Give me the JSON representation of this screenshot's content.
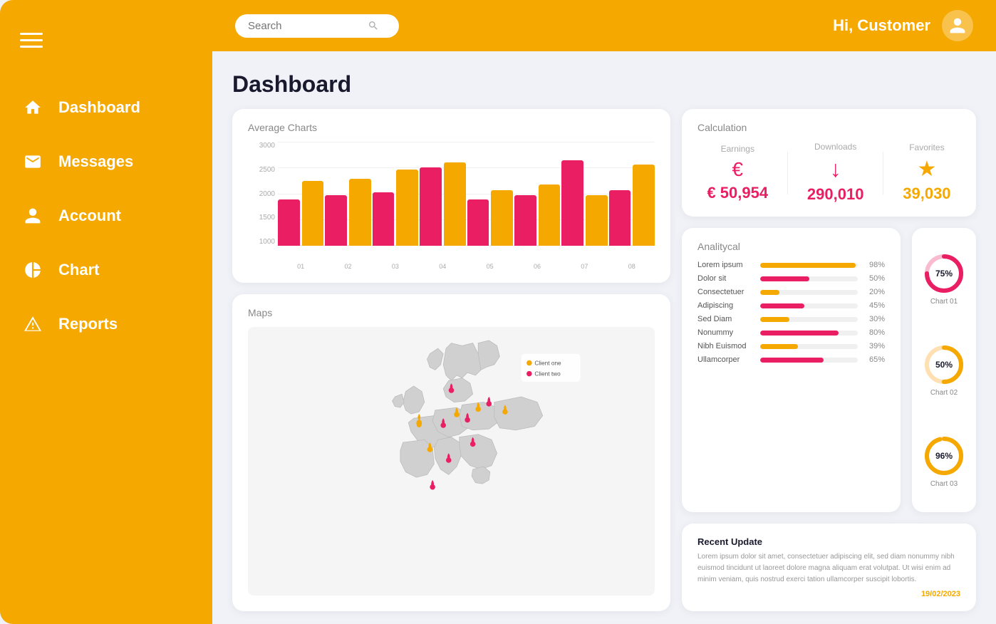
{
  "sidebar": {
    "items": [
      {
        "id": "dashboard",
        "label": "Dashboard",
        "icon": "home"
      },
      {
        "id": "messages",
        "label": "Messages",
        "icon": "mail"
      },
      {
        "id": "account",
        "label": "Account",
        "icon": "user"
      },
      {
        "id": "chart",
        "label": "Chart",
        "icon": "pie"
      },
      {
        "id": "reports",
        "label": "Reports",
        "icon": "alert"
      }
    ],
    "active": "dashboard"
  },
  "header": {
    "search_placeholder": "Search",
    "greeting": "Hi, Customer"
  },
  "page": {
    "title": "Dashboard"
  },
  "average_charts": {
    "title": "Average Charts",
    "y_labels": [
      "3000",
      "2500",
      "2000",
      "1500",
      "1000"
    ],
    "x_labels": [
      "01",
      "02",
      "03",
      "04",
      "05",
      "06",
      "07",
      "08"
    ],
    "bars": [
      {
        "pink": 50,
        "orange": 70
      },
      {
        "pink": 55,
        "orange": 72
      },
      {
        "pink": 58,
        "orange": 82
      },
      {
        "pink": 85,
        "orange": 90
      },
      {
        "pink": 50,
        "orange": 60
      },
      {
        "pink": 55,
        "orange": 66
      },
      {
        "pink": 92,
        "orange": 55
      },
      {
        "pink": 60,
        "orange": 88
      }
    ]
  },
  "maps": {
    "title": "Maps",
    "legend": [
      {
        "label": "Client one",
        "color": "#f5a800"
      },
      {
        "label": "Client two",
        "color": "#e91e63"
      }
    ]
  },
  "calculation": {
    "title": "Calculation",
    "earnings": {
      "label": "Earnings",
      "icon": "€",
      "value": "€ 50,954",
      "color": "pink"
    },
    "downloads": {
      "label": "Downloads",
      "icon": "↓",
      "value": "290,010",
      "color": "pink"
    },
    "favorites": {
      "label": "Favorites",
      "icon": "★",
      "value": "39,030",
      "color": "orange"
    }
  },
  "analytical": {
    "title": "Analitycal",
    "rows": [
      {
        "label": "Lorem ipsum",
        "pct": 98,
        "color": "orange"
      },
      {
        "label": "Dolor sit",
        "pct": 50,
        "color": "pink"
      },
      {
        "label": "Consectetuer",
        "pct": 20,
        "color": "orange"
      },
      {
        "label": "Adipiscing",
        "pct": 45,
        "color": "pink"
      },
      {
        "label": "Sed Diam",
        "pct": 30,
        "color": "orange"
      },
      {
        "label": "Nonummy",
        "pct": 80,
        "color": "pink"
      },
      {
        "label": "Nibh Euismod",
        "pct": 39,
        "color": "orange"
      },
      {
        "label": "Ullamcorper",
        "pct": 65,
        "color": "pink"
      }
    ]
  },
  "donuts": [
    {
      "label": "Chart 01",
      "pct": 75,
      "color": "#e91e63",
      "bg": "#f8bbd0",
      "center": "75%"
    },
    {
      "label": "Chart 02",
      "pct": 50,
      "color": "#f5a800",
      "bg": "#ffe0b2",
      "center": "50%"
    },
    {
      "label": "Chart 03",
      "pct": 96,
      "color": "#f5a800",
      "bg": "#ffe0b2",
      "center": "96%"
    }
  ],
  "recent_update": {
    "title": "Recent Update",
    "text": "Lorem ipsum dolor sit amet, consectetuer adipiscing elit, sed diam nonummy nibh euismod tincidunt ut laoreet dolore magna aliquam erat volutpat. Ut wisi enim ad minim veniam, quis nostrud exerci tation ullamcorper suscipit lobortis.",
    "date": "19/02/2023"
  },
  "colors": {
    "orange": "#f5a800",
    "pink": "#e91e63",
    "sidebar_bg": "#f5a800"
  }
}
